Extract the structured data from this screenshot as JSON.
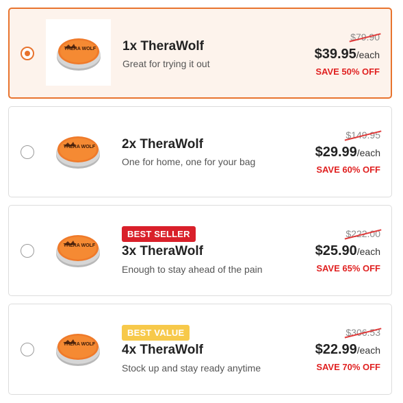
{
  "offers": [
    {
      "name": "1x TheraWolf",
      "description": "Great for trying it out",
      "badge": "",
      "old_price": "$79.90",
      "price": "$39.95",
      "unit": "/each",
      "save": "SAVE 50% OFF",
      "selected": true,
      "lid_text": "THERA WOLF"
    },
    {
      "name": "2x TheraWolf",
      "description": "One for home, one for your bag",
      "badge": "",
      "old_price": "$149.95",
      "price": "$29.99",
      "unit": "/each",
      "save": "SAVE 60% OFF",
      "selected": false,
      "lid_text": "THERA WOLF"
    },
    {
      "name": "3x TheraWolf",
      "description": "Enough to stay ahead of the pain",
      "badge": "BEST SELLER",
      "old_price": "$222.00",
      "price": "$25.90",
      "unit": "/each",
      "save": "SAVE 65% OFF",
      "selected": false,
      "lid_text": "THERA WOLF"
    },
    {
      "name": "4x TheraWolf",
      "description": "Stock up and stay ready anytime",
      "badge": "BEST VALUE",
      "old_price": "$306.53",
      "price": "$22.99",
      "unit": "/each",
      "save": "SAVE 70% OFF",
      "selected": false,
      "lid_text": "THERA WOLF"
    }
  ],
  "colors": {
    "accent": "#e8732d",
    "selected_bg": "#fdf3ec",
    "save_red": "#e02020",
    "badge_red": "#d9202a",
    "badge_yellow": "#f7c94a"
  }
}
